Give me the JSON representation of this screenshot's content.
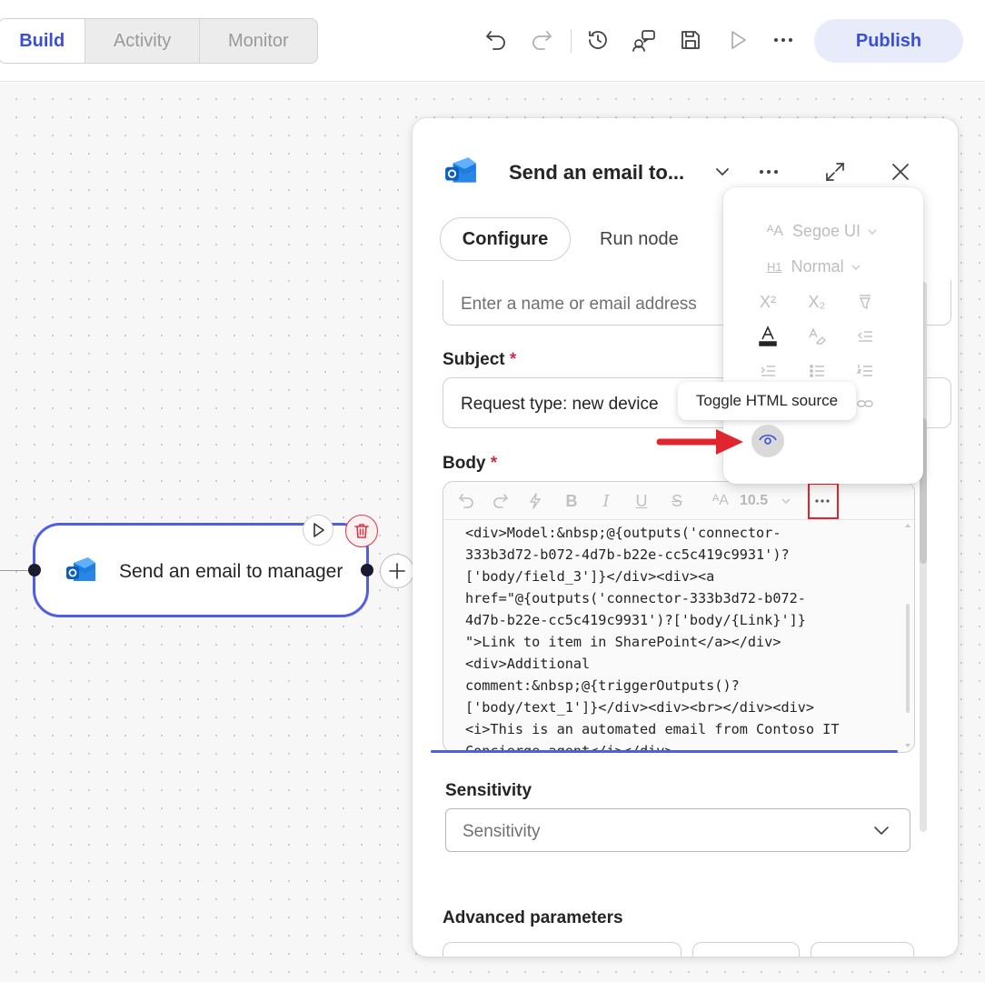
{
  "topbar": {
    "tabs": [
      {
        "label": "Build",
        "active": true
      },
      {
        "label": "Activity",
        "active": false
      },
      {
        "label": "Monitor",
        "active": false
      }
    ],
    "publish_label": "Publish",
    "icons": [
      "undo-icon",
      "redo-icon",
      "history-icon",
      "flow-checker-icon",
      "save-icon",
      "test-icon",
      "more-icon"
    ]
  },
  "canvas": {
    "node": {
      "title": "Send an email to manager",
      "logo": "outlook-icon"
    }
  },
  "panel": {
    "title": "Send an email to...",
    "tabs": {
      "configure": "Configure",
      "run_node": "Run node"
    },
    "to_placeholder": "Enter a name or email address",
    "subject": {
      "label": "Subject",
      "required_mark": "*",
      "value": "Request type: new device"
    },
    "body": {
      "label": "Body",
      "required_mark": "*",
      "font_size": "10.5",
      "code_lines": [
        "<div>Model:&nbsp;@{outputs('connector-",
        "333b3d72-b072-4d7b-b22e-cc5c419c9931')?",
        "['body/field_3']}</div><div><a",
        "href=\"@{outputs('connector-333b3d72-b072-",
        "4d7b-b22e-cc5c419c9931')?['body/{Link}']}",
        "\">Link to item in SharePoint</a></div>",
        "<div>Additional",
        "comment:&nbsp;@{triggerOutputs()?",
        "['body/text_1']}</div><div><br></div><div>",
        "<i>This is an automated email from Contoso IT",
        "Concierge agent</i></div>"
      ]
    },
    "sensitivity": {
      "label": "Sensitivity",
      "placeholder": "Sensitivity"
    },
    "advanced_label": "Advanced parameters"
  },
  "flyout": {
    "font_family": "Segoe UI",
    "heading": "Normal",
    "tooltip": "Toggle HTML source"
  },
  "colors": {
    "accent": "#4f5fe0",
    "brand_text": "#3a4fd6",
    "required": "#c4314b",
    "highlight_box": "#e0252f",
    "arrow": "#e0252f"
  }
}
